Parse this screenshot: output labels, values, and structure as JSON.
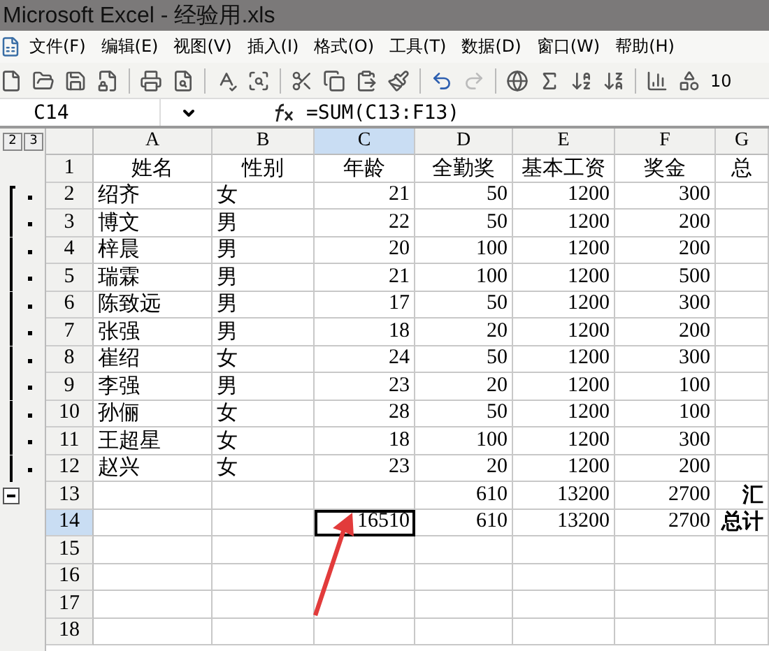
{
  "window": {
    "title": "Microsoft Excel - 经验用.xls"
  },
  "menu": [
    "文件(F)",
    "编辑(E)",
    "视图(V)",
    "插入(I)",
    "格式(O)",
    "工具(T)",
    "数据(D)",
    "窗口(W)",
    "帮助(H)"
  ],
  "toolbar": {
    "zoom": "10"
  },
  "formula_bar": {
    "name_box": "C14",
    "formula": "=SUM(C13:F13)"
  },
  "outline_levels": [
    "2",
    "3"
  ],
  "outline_group": {
    "expanded": true
  },
  "columns": [
    {
      "label": "A",
      "kind": "text",
      "selected": false
    },
    {
      "label": "B",
      "kind": "text",
      "selected": false
    },
    {
      "label": "C",
      "kind": "number",
      "selected": true
    },
    {
      "label": "D",
      "kind": "number",
      "selected": false
    },
    {
      "label": "E",
      "kind": "number",
      "selected": false
    },
    {
      "label": "F",
      "kind": "number",
      "selected": false
    },
    {
      "label": "G",
      "kind": "text",
      "selected": false
    }
  ],
  "rows": [
    {
      "number": "1",
      "kind": "header",
      "in_group": false,
      "selected": false,
      "cells": [
        "姓名",
        "性别",
        "年龄",
        "全勤奖",
        "基本工资",
        "奖金",
        "总"
      ]
    },
    {
      "number": "2",
      "kind": "data",
      "in_group": true,
      "selected": false,
      "cells": [
        "绍齐",
        "女",
        "21",
        "50",
        "1200",
        "300",
        ""
      ]
    },
    {
      "number": "3",
      "kind": "data",
      "in_group": true,
      "selected": false,
      "cells": [
        "博文",
        "男",
        "22",
        "50",
        "1200",
        "200",
        ""
      ]
    },
    {
      "number": "4",
      "kind": "data",
      "in_group": true,
      "selected": false,
      "cells": [
        "梓晨",
        "男",
        "20",
        "100",
        "1200",
        "200",
        ""
      ]
    },
    {
      "number": "5",
      "kind": "data",
      "in_group": true,
      "selected": false,
      "cells": [
        "瑞霖",
        "男",
        "21",
        "100",
        "1200",
        "500",
        ""
      ]
    },
    {
      "number": "6",
      "kind": "data",
      "in_group": true,
      "selected": false,
      "cells": [
        "陈致远",
        "男",
        "17",
        "50",
        "1200",
        "300",
        ""
      ]
    },
    {
      "number": "7",
      "kind": "data",
      "in_group": true,
      "selected": false,
      "cells": [
        "张强",
        "男",
        "18",
        "20",
        "1200",
        "200",
        ""
      ]
    },
    {
      "number": "8",
      "kind": "data",
      "in_group": true,
      "selected": false,
      "cells": [
        "崔绍",
        "女",
        "24",
        "50",
        "1200",
        "300",
        ""
      ]
    },
    {
      "number": "9",
      "kind": "data",
      "in_group": true,
      "selected": false,
      "cells": [
        "李强",
        "男",
        "23",
        "20",
        "1200",
        "100",
        ""
      ]
    },
    {
      "number": "10",
      "kind": "data",
      "in_group": true,
      "selected": false,
      "cells": [
        "孙俪",
        "女",
        "28",
        "50",
        "1200",
        "100",
        ""
      ]
    },
    {
      "number": "11",
      "kind": "data",
      "in_group": true,
      "selected": false,
      "cells": [
        "王超星",
        "女",
        "18",
        "100",
        "1200",
        "300",
        ""
      ]
    },
    {
      "number": "12",
      "kind": "data",
      "in_group": true,
      "selected": false,
      "cells": [
        "赵兴",
        "女",
        "23",
        "20",
        "1200",
        "200",
        ""
      ]
    },
    {
      "number": "13",
      "kind": "total",
      "in_group": false,
      "selected": false,
      "cells": [
        "",
        "",
        "",
        "610",
        "13200",
        "2700",
        "汇"
      ]
    },
    {
      "number": "14",
      "kind": "total",
      "in_group": false,
      "selected": true,
      "cells": [
        "",
        "",
        "16510",
        "610",
        "13200",
        "2700",
        "总计"
      ]
    },
    {
      "number": "15",
      "kind": "data",
      "in_group": false,
      "selected": false,
      "cells": [
        "",
        "",
        "",
        "",
        "",
        "",
        ""
      ]
    },
    {
      "number": "16",
      "kind": "data",
      "in_group": false,
      "selected": false,
      "cells": [
        "",
        "",
        "",
        "",
        "",
        "",
        ""
      ]
    },
    {
      "number": "17",
      "kind": "data",
      "in_group": false,
      "selected": false,
      "cells": [
        "",
        "",
        "",
        "",
        "",
        "",
        ""
      ]
    },
    {
      "number": "18",
      "kind": "data",
      "in_group": false,
      "selected": false,
      "cells": [
        "",
        "",
        "",
        "",
        "",
        "",
        ""
      ]
    }
  ]
}
